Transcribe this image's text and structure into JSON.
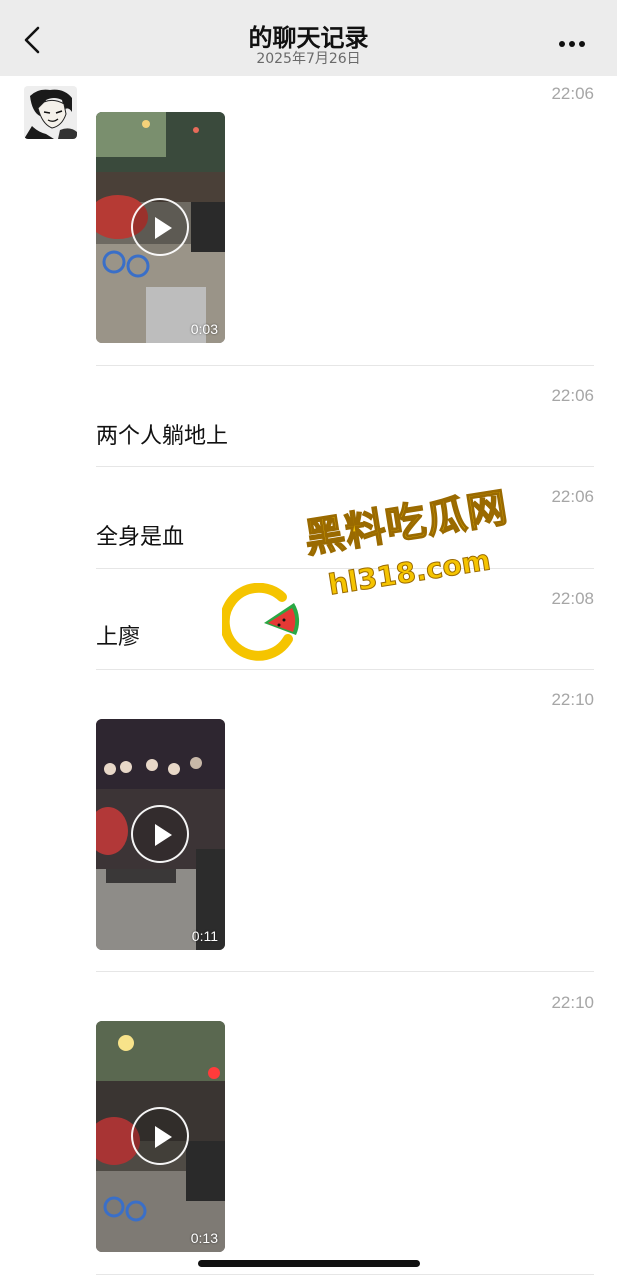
{
  "header": {
    "title": "的聊天记录",
    "date": "2025年7月26日"
  },
  "messages": [
    {
      "type": "video",
      "time": "22:06",
      "duration": "0:03"
    },
    {
      "type": "text",
      "time": "22:06",
      "text": "两个人躺地上"
    },
    {
      "type": "text",
      "time": "22:06",
      "text": "全身是血"
    },
    {
      "type": "text",
      "time": "22:08",
      "text": "上廖"
    },
    {
      "type": "video",
      "time": "22:10",
      "duration": "0:11"
    },
    {
      "type": "video",
      "time": "22:10",
      "duration": "0:13"
    }
  ],
  "watermark": {
    "title": "黑料吃瓜网",
    "domain": "hl318.com"
  },
  "colors": {
    "header_bg": "#ececec",
    "time_text": "#a6a6a6",
    "divider": "#e6e6e6",
    "watermark_yellow": "#f5c400",
    "watermark_green": "#2aa844",
    "watermark_red": "#e53935"
  },
  "icons": {
    "back": "chevron-left-icon",
    "more": "more-dots-icon",
    "play": "play-icon"
  }
}
